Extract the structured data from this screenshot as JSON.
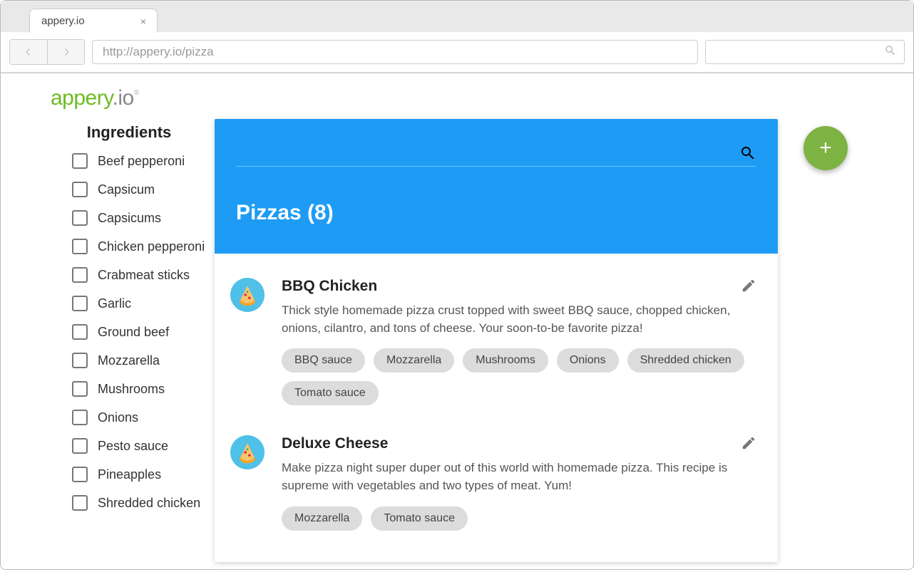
{
  "browser": {
    "tab_title": "appery.io",
    "url": "http://appery.io/pizza"
  },
  "logo": {
    "part1": "appery",
    "part2": ".io"
  },
  "sidebar": {
    "title": "Ingredients",
    "items": [
      "Beef pepperoni",
      "Capsicum",
      "Capsicums",
      "Chicken pepperoni",
      "Crabmeat sticks",
      "Garlic",
      "Ground beef",
      "Mozzarella",
      "Mushrooms",
      "Onions",
      "Pesto sauce",
      "Pineapples",
      "Shredded chicken"
    ]
  },
  "main": {
    "title_prefix": "Pizzas",
    "count": 8,
    "pizzas": [
      {
        "name": "BBQ Chicken",
        "description": "Thick style homemade pizza crust topped with sweet BBQ sauce, chopped chicken, onions, cilantro, and tons of cheese. Your soon-to-be favorite pizza!",
        "tags": [
          "BBQ sauce",
          "Mozzarella",
          "Mushrooms",
          "Onions",
          "Shredded chicken",
          "Tomato sauce"
        ]
      },
      {
        "name": "Deluxe Cheese",
        "description": "Make pizza night super duper out of this world with homemade pizza. This recipe is supreme with vegetables and two types of meat. Yum!",
        "tags": [
          "Mozzarella",
          "Tomato sauce"
        ]
      }
    ]
  }
}
